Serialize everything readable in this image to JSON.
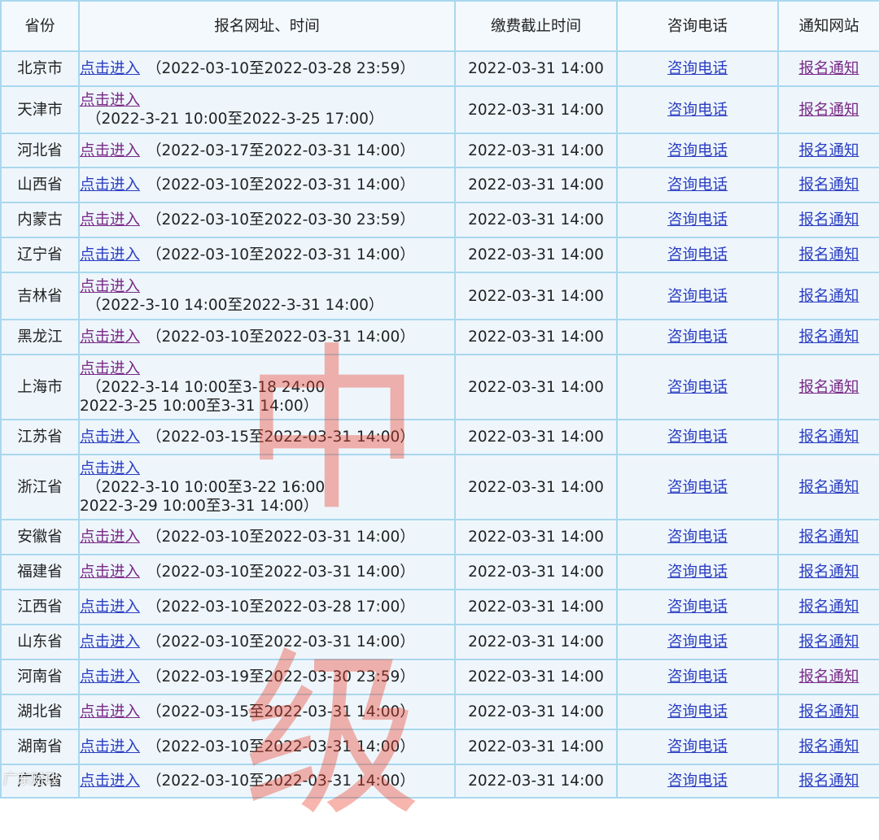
{
  "headers": [
    "省份",
    "报名网址、时间",
    "缴费截止时间",
    "咨询电话",
    "通知网站"
  ],
  "link_label": "点击进入",
  "phone_label": "咨询电话",
  "notice_label": "报名通知",
  "watermark": "中级",
  "footer_logo": "广东财政",
  "rows": [
    {
      "province": "北京市",
      "reg_time": "（2022-03-10至2022-03-28 23:59）",
      "deadline": "2022-03-31 14:00",
      "layout": "inline",
      "link_visited": false,
      "notice_visited": true
    },
    {
      "province": "天津市",
      "reg_time": "（2022-3-21 10:00至2022-3-25 17:00）",
      "deadline": "2022-03-31 14:00",
      "layout": "block",
      "link_visited": true,
      "notice_visited": true
    },
    {
      "province": "河北省",
      "reg_time": "（2022-03-17至2022-03-31 14:00）",
      "deadline": "2022-03-31 14:00",
      "layout": "inline",
      "link_visited": true,
      "notice_visited": false
    },
    {
      "province": "山西省",
      "reg_time": "（2022-03-10至2022-03-31 14:00）",
      "deadline": "2022-03-31 14:00",
      "layout": "inline",
      "link_visited": false,
      "notice_visited": false
    },
    {
      "province": "内蒙古",
      "reg_time": "（2022-03-10至2022-03-30 23:59）",
      "deadline": "2022-03-31 14:00",
      "layout": "inline",
      "link_visited": true,
      "notice_visited": false
    },
    {
      "province": "辽宁省",
      "reg_time": "（2022-03-10至2022-03-31 14:00）",
      "deadline": "2022-03-31 14:00",
      "layout": "inline",
      "link_visited": false,
      "notice_visited": false
    },
    {
      "province": "吉林省",
      "reg_time": "（2022-3-10 14:00至2022-3-31 14:00）",
      "deadline": "2022-03-31 14:00",
      "layout": "block",
      "link_visited": true,
      "notice_visited": false
    },
    {
      "province": "黑龙江",
      "reg_time": "（2022-03-10至2022-03-31 14:00）",
      "deadline": "2022-03-31 14:00",
      "layout": "inline",
      "link_visited": true,
      "notice_visited": false
    },
    {
      "province": "上海市",
      "reg_time": "（2022-3-14 10:00至3-18 24:00",
      "reg_time2": "2022-3-25 10:00至3-31 14:00）",
      "deadline": "2022-03-31 14:00",
      "layout": "two",
      "link_visited": true,
      "notice_visited": true
    },
    {
      "province": "江苏省",
      "reg_time": "（2022-03-15至2022-03-31 14:00）",
      "deadline": "2022-03-31 14:00",
      "layout": "inline",
      "link_visited": false,
      "notice_visited": false
    },
    {
      "province": "浙江省",
      "reg_time": "（2022-3-10 10:00至3-22 16:00",
      "reg_time2": "2022-3-29 10:00至3-31 14:00）",
      "deadline": "2022-03-31 14:00",
      "layout": "two",
      "link_visited": false,
      "notice_visited": false
    },
    {
      "province": "安徽省",
      "reg_time": "（2022-03-10至2022-03-31 14:00）",
      "deadline": "2022-03-31 14:00",
      "layout": "inline",
      "link_visited": true,
      "notice_visited": false
    },
    {
      "province": "福建省",
      "reg_time": "（2022-03-10至2022-03-31 14:00）",
      "deadline": "2022-03-31 14:00",
      "layout": "inline",
      "link_visited": true,
      "notice_visited": false
    },
    {
      "province": "江西省",
      "reg_time": "（2022-03-10至2022-03-28 17:00）",
      "deadline": "2022-03-31 14:00",
      "layout": "inline",
      "link_visited": false,
      "notice_visited": false
    },
    {
      "province": "山东省",
      "reg_time": "（2022-03-10至2022-03-31 14:00）",
      "deadline": "2022-03-31 14:00",
      "layout": "inline",
      "link_visited": false,
      "notice_visited": false
    },
    {
      "province": "河南省",
      "reg_time": "（2022-03-19至2022-03-30 23:59）",
      "deadline": "2022-03-31 14:00",
      "layout": "inline",
      "link_visited": false,
      "notice_visited": true
    },
    {
      "province": "湖北省",
      "reg_time": "（2022-03-15至2022-03-31 14:00）",
      "deadline": "2022-03-31 14:00",
      "layout": "inline",
      "link_visited": true,
      "notice_visited": false
    },
    {
      "province": "湖南省",
      "reg_time": "（2022-03-10至2022-03-31 14:00）",
      "deadline": "2022-03-31 14:00",
      "layout": "inline",
      "link_visited": false,
      "notice_visited": false
    },
    {
      "province": "广东省",
      "reg_time": "（2022-03-10至2022-03-31 14:00）",
      "deadline": "2022-03-31 14:00",
      "layout": "inline",
      "link_visited": false,
      "notice_visited": false
    }
  ]
}
